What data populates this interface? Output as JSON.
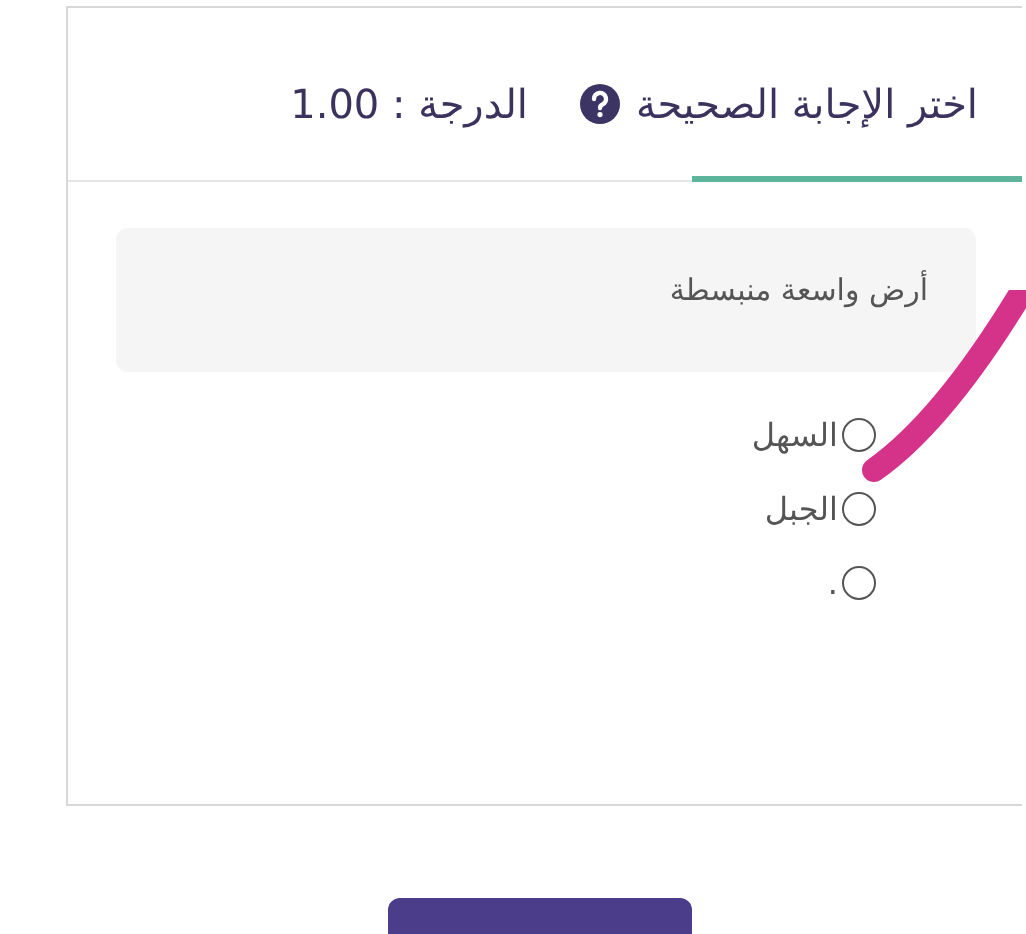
{
  "header": {
    "title": "اختر الإجابة الصحيحة",
    "grade": "الدرجة : 1.00"
  },
  "question": {
    "text": "أرض واسعة منبسطة"
  },
  "options": [
    {
      "label": "السهل",
      "selected": false
    },
    {
      "label": "الجبل",
      "selected": false
    },
    {
      "label": ".",
      "selected": false
    }
  ]
}
